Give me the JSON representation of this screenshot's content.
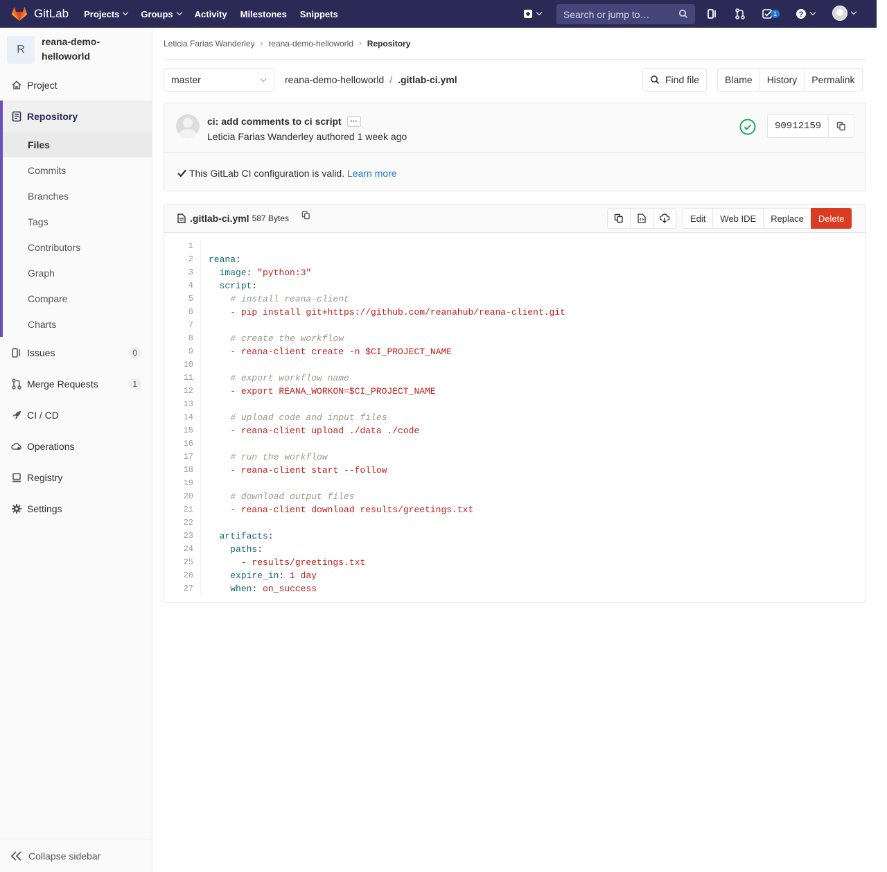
{
  "topbar": {
    "brand": "GitLab",
    "nav": [
      "Projects",
      "Groups",
      "Activity",
      "Milestones",
      "Snippets"
    ],
    "search_placeholder": "Search or jump to…",
    "todo_count": "1"
  },
  "sidebar": {
    "project_initial": "R",
    "project_name": "reana-demo-helloworld",
    "project_label": "Project",
    "repository_label": "Repository",
    "repo_items": [
      "Files",
      "Commits",
      "Branches",
      "Tags",
      "Contributors",
      "Graph",
      "Compare",
      "Charts"
    ],
    "issues_label": "Issues",
    "issues_count": "0",
    "mr_label": "Merge Requests",
    "mr_count": "1",
    "cicd_label": "CI / CD",
    "operations_label": "Operations",
    "registry_label": "Registry",
    "settings_label": "Settings",
    "collapse_label": "Collapse sidebar"
  },
  "breadcrumb": [
    "Leticia Farias Wanderley",
    "reana-demo-helloworld",
    "Repository"
  ],
  "filebar": {
    "branch": "master",
    "repo_path": "reana-demo-helloworld",
    "file_path": ".gitlab-ci.yml",
    "find_file": "Find file",
    "blame": "Blame",
    "history": "History",
    "permalink": "Permalink"
  },
  "commit": {
    "title": "ci: add comments to ci script",
    "author_line": "Leticia Farias Wanderley authored 1 week ago",
    "sha": "90912159",
    "valid_text": "This GitLab CI configuration is valid.",
    "learn_more": "Learn more"
  },
  "file": {
    "name": ".gitlab-ci.yml",
    "size": "587 Bytes",
    "edit": "Edit",
    "web_ide": "Web IDE",
    "replace": "Replace",
    "delete": "Delete"
  },
  "code_lines": [
    "",
    "reana:",
    "  image: \"python:3\"",
    "  script:",
    "    # install reana-client",
    "    - pip install git+https://github.com/reanahub/reana-client.git",
    "",
    "    # create the workflow",
    "    - reana-client create -n $CI_PROJECT_NAME",
    "",
    "    # export workflow name",
    "    - export REANA_WORKON=$CI_PROJECT_NAME",
    "",
    "    # upload code and input files",
    "    - reana-client upload ./data ./code",
    "",
    "    # run the workflow",
    "    - reana-client start --follow",
    "",
    "    # download output files",
    "    - reana-client download results/greetings.txt",
    "",
    "  artifacts:",
    "    paths:",
    "      - results/greetings.txt",
    "    expire_in: 1 day",
    "    when: on_success"
  ],
  "colors": {
    "topbar": "#2b2a57",
    "accent": "#6b4fbb",
    "link": "#1f78d1",
    "danger": "#db3b21",
    "success": "#1aaa55"
  }
}
